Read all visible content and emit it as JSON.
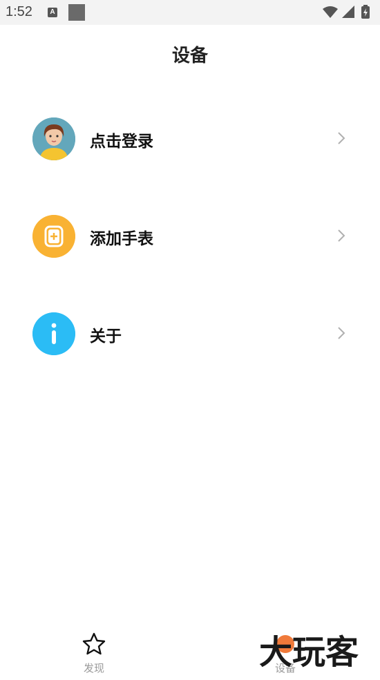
{
  "status_bar": {
    "time": "1:52",
    "notification_letter": "A"
  },
  "header": {
    "title": "设备"
  },
  "menu": {
    "items": [
      {
        "label": "点击登录",
        "icon": "avatar-icon"
      },
      {
        "label": "添加手表",
        "icon": "watch-add-icon"
      },
      {
        "label": "关于",
        "icon": "info-icon"
      }
    ]
  },
  "tabs": [
    {
      "label": "发现",
      "icon": "star-icon"
    },
    {
      "label": "设备",
      "icon": "device-icon"
    }
  ],
  "watermark": {
    "text": "大玩客"
  },
  "colors": {
    "accent_orange": "#f9b233",
    "info_blue": "#2bbcf5",
    "tab_text": "#9a9a9a"
  }
}
